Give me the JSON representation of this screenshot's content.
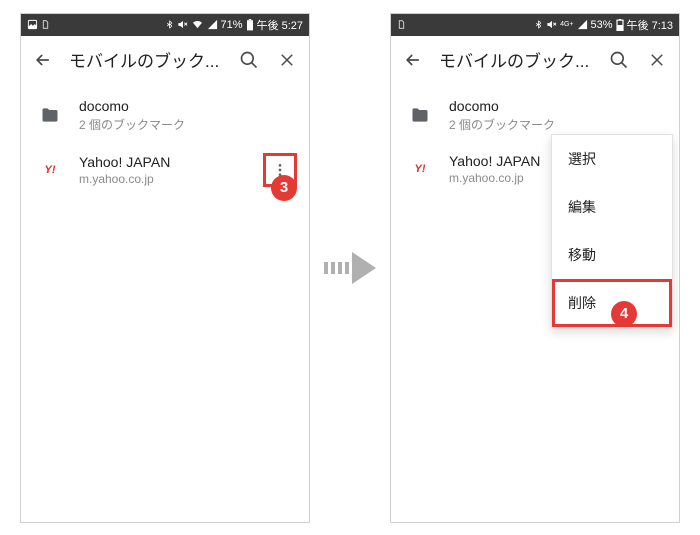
{
  "left": {
    "statusbar": {
      "battery": "71%",
      "time": "午後 5:27"
    },
    "header": {
      "title": "モバイルのブック..."
    },
    "folder": {
      "title": "docomo",
      "sub": "2 個のブックマーク"
    },
    "bookmark": {
      "title": "Yahoo! JAPAN",
      "sub": "m.yahoo.co.jp",
      "favicon_text": "Y!"
    },
    "callout": "3"
  },
  "right": {
    "statusbar": {
      "battery": "53%",
      "time": "午後 7:13"
    },
    "header": {
      "title": "モバイルのブック..."
    },
    "folder": {
      "title": "docomo",
      "sub": "2 個のブックマーク"
    },
    "bookmark": {
      "title": "Yahoo! JAPAN",
      "sub": "m.yahoo.co.jp",
      "favicon_text": "Y!"
    },
    "menu": {
      "select": "選択",
      "edit": "編集",
      "move": "移動",
      "delete": "削除"
    },
    "callout": "4"
  }
}
